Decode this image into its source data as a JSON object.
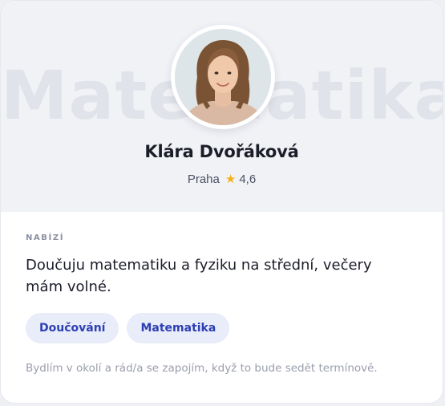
{
  "profile": {
    "watermark": "Matematika",
    "name": "Klára Dvořáková",
    "city": "Praha",
    "rating": "4,6",
    "avatar_icon": "person-portrait"
  },
  "offer": {
    "label": "NABÍZÍ",
    "text": "Doučuju matematiku a fyziku na střední, večery mám volné.",
    "tags": [
      "Doučování",
      "Matematika"
    ],
    "note": "Bydlím v okolí a rád/a se zapojím, když to bude sedět termínově."
  },
  "colors": {
    "accent": "#2c40b3",
    "tag_bg": "#e9ecf9",
    "star": "#f2b21b"
  }
}
